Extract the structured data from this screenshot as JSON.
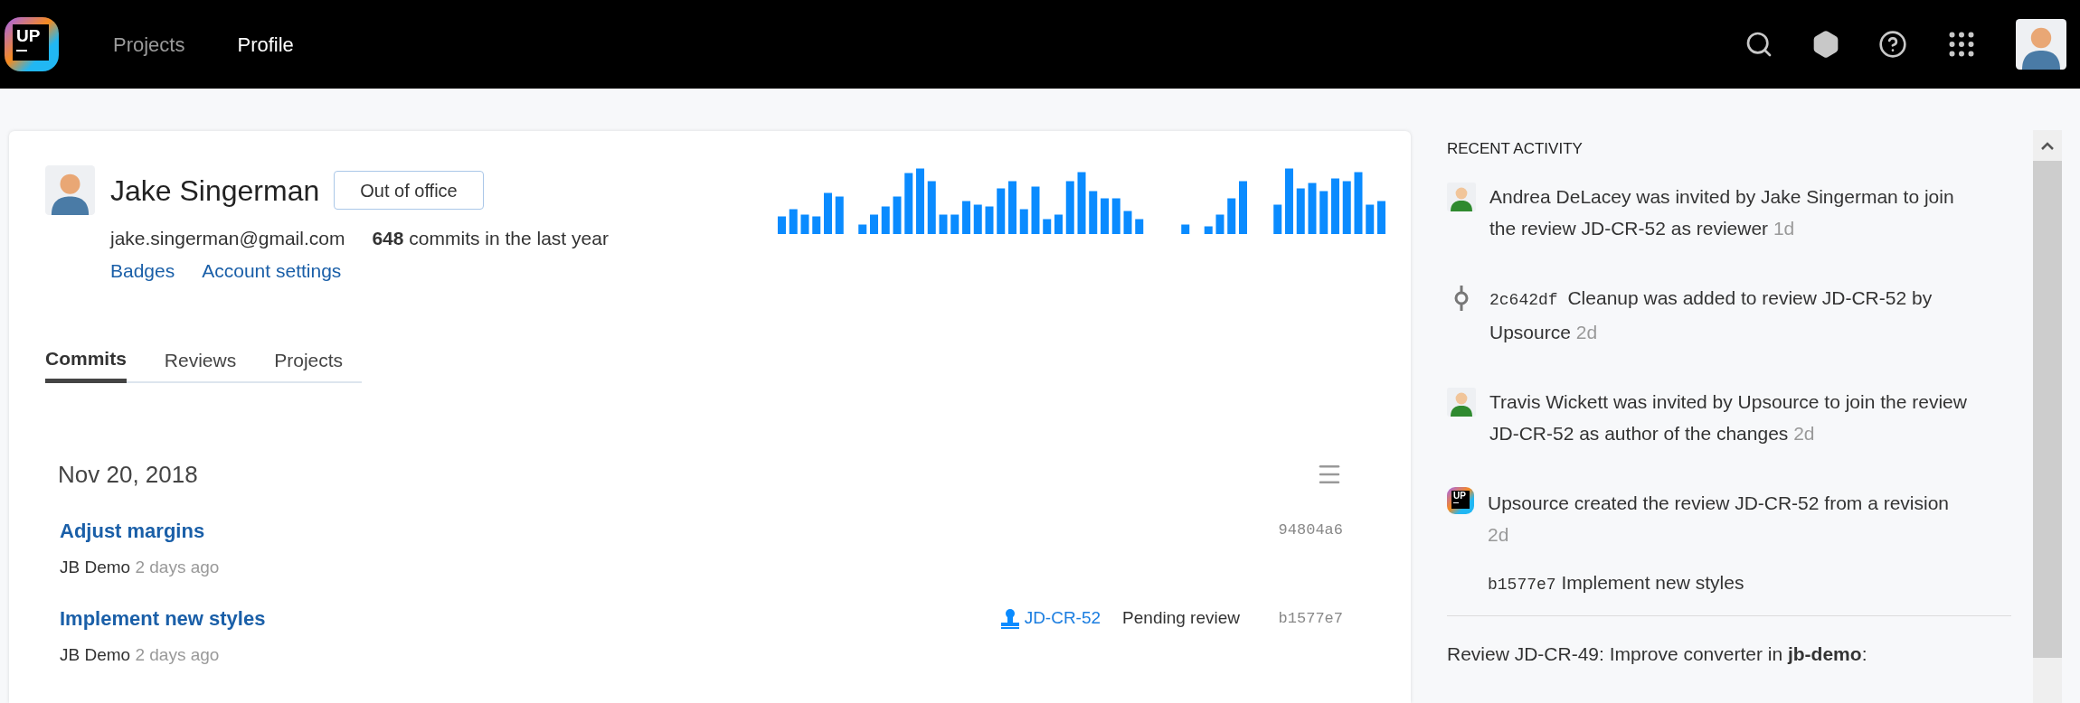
{
  "header": {
    "logo_text": "UP",
    "nav": [
      {
        "label": "Projects",
        "selected": false
      },
      {
        "label": "Profile",
        "selected": true
      }
    ]
  },
  "profile": {
    "name": "Jake Singerman",
    "status_button": "Out of office",
    "email": "jake.singerman@gmail.com",
    "commit_count": "648",
    "commit_caption": "commits in the last year",
    "links": [
      "Badges",
      "Account settings"
    ]
  },
  "tabs": [
    {
      "label": "Commits",
      "selected": true
    },
    {
      "label": "Reviews",
      "selected": false
    },
    {
      "label": "Projects",
      "selected": false
    }
  ],
  "commits": {
    "date": "Nov 20, 2018",
    "items": [
      {
        "title": "Adjust margins",
        "project": "JB Demo",
        "time": "2 days ago",
        "hash": "94804a6"
      },
      {
        "title": "Implement new styles",
        "project": "JB Demo",
        "time": "2 days ago",
        "review": {
          "id": "JD-CR-52",
          "status": "Pending review"
        },
        "hash": "b1577e7"
      }
    ]
  },
  "recent_activity": {
    "title": "RECENT ACTIVITY",
    "items": [
      {
        "kind": "person",
        "text": "Andrea DeLacey was invited by Jake Singerman to join the review JD-CR-52 as reviewer",
        "time": "1d"
      },
      {
        "kind": "commit",
        "code": "2c642df",
        "text": "Cleanup was added to review JD-CR-52 by Upsource",
        "time": "2d"
      },
      {
        "kind": "person",
        "text": "Travis Wickett was invited by Upsource to join the review JD-CR-52 as author of the changes",
        "time": "2d"
      },
      {
        "kind": "system",
        "icon_text": "UP",
        "text": "Upsource created the review JD-CR-52 from a revision",
        "time": "2d",
        "detail": {
          "code": "b1577e7",
          "text": "Implement new styles"
        }
      }
    ],
    "footer": "Review JD-CR-49: Improve converter in **jb-demo**:"
  }
}
